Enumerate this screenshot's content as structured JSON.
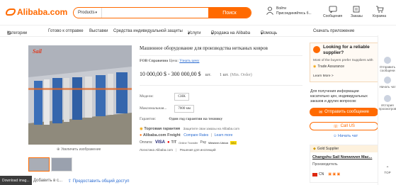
{
  "header": {
    "logo_text": "Alibaba.com",
    "search_category": "Products",
    "search_button": "Поиск",
    "user_line1": "Войти",
    "user_line2": "Присоединяйтесь б...",
    "messages": "Сообщения",
    "orders": "Заказы",
    "cart": "Корзина"
  },
  "nav": {
    "items": [
      "Категории",
      "Готово к отправке",
      "Выставки",
      "Средства индивидуальной защиты",
      "Услуги",
      "Продажа на Alibaba",
      "Помощь"
    ],
    "app": "Скачать приложение"
  },
  "gallery": {
    "watermark": "Sail",
    "zoom_label": "Увеличить изображение",
    "add_compare": "Добавить в с...",
    "share": "Предоставить общий доступ"
  },
  "product": {
    "title": "Машинное оборудование для производства нетканых ковров",
    "fob_label": "FOB Справочно",
    "price_label": "Цена:",
    "latest_price": "Узнать цену",
    "price": "10 000,00 $ - 300 000,00 $",
    "price_unit": "шт.",
    "moq": "1 шт.",
    "moq_note": "(Min. Order)",
    "model_label": "Модели:",
    "model_value": "CHK",
    "max_width_label": "Максимальная...",
    "max_width_value": "7000 мм",
    "warranty_label": "Гарантия:",
    "warranty_value": "Один год гарантии на технику",
    "trade_assurance": "Торговая гарантия",
    "trade_note": "Защитите свои заказы на Alibaba.com",
    "freight": "Alibaba.com Freight",
    "compare_rates": "Compare Rates",
    "learn_more": "Learn more",
    "payment_label": "Оплата:",
    "payments": [
      "VISA",
      "T/T",
      "Online Transfer",
      "Pay",
      "Western Union",
      "WU"
    ],
    "logistics": "Логистика Alibaba.com",
    "inspection": "Решения для инспекций"
  },
  "right": {
    "reliable_title": "Looking for a reliable supplier?",
    "reliable_note": "Most of the buyers prefer Suppliers with",
    "trade_assurance": "Trade Assurance",
    "learn_more": "Learn More >",
    "info_text": "Для получения информации касательно цен, индивидуальных заказов и других вопросов:",
    "send_message": "Отправить сообщение",
    "call": "Call US",
    "chat": "Начать чат",
    "gold_supplier": "Gold Supplier",
    "supplier_name": "Changshu Sail Nonwoven Mac...",
    "manufacturer": "Производитель",
    "country": "CN"
  },
  "sidebar": {
    "send": "Отправить сообщени",
    "chat": "Начать чат",
    "history": "История просмотров",
    "top": "TOP"
  },
  "download": "Download imag..."
}
